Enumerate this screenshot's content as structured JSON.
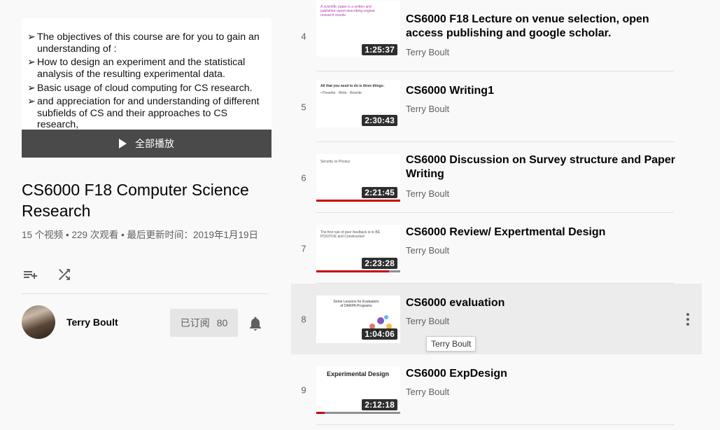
{
  "hero": {
    "bullets": [
      "The objectives of this course are for you to gain an",
      "understanding of :",
      "How to design an experiment and the statistical",
      "analysis of the resulting experimental data.",
      "Basic usage of cloud computing for CS research.",
      "and appreciation for and understanding of different",
      "subfields of CS and their approaches to CS",
      "research,"
    ],
    "play_all": "全部播放"
  },
  "playlist": {
    "title": "CS6000 F18 Computer Science Research",
    "stats": "15 个视频 • 229 次观看 • 最后更新时间：2019年1月19日",
    "owner": "Terry Boult",
    "subscribe_label": "已订阅",
    "subscriber_count": "80"
  },
  "videos": [
    {
      "index": "4",
      "title": "CS6000 F18 Lecture on venue selection, open access publishing and google scholar.",
      "channel": "Terry Boult",
      "duration": "1:25:37",
      "progress": 0
    },
    {
      "index": "5",
      "title": "CS6000 Writing1",
      "channel": "Terry Boult",
      "duration": "2:30:43",
      "progress": 0
    },
    {
      "index": "6",
      "title": "CS6000 Discussion on Survey structure and Paper Writing",
      "channel": "Terry Boult",
      "duration": "2:21:45",
      "progress": 1.0
    },
    {
      "index": "7",
      "title": "CS6000 Review/ Expertmental Design",
      "channel": "Terry Boult",
      "duration": "2:23:28",
      "progress": 0.87
    },
    {
      "index": "8",
      "title": "CS6000 evaluation",
      "channel": "Terry Boult",
      "duration": "1:04:06",
      "progress": 0
    },
    {
      "index": "9",
      "title": "CS6000 ExpDesign",
      "channel": "Terry Boult",
      "duration": "2:12:18",
      "progress": 0.1
    }
  ],
  "thumb_text": {
    "v4": "A scientific paper is a written and published report describing original research results.",
    "v5": "All that you need to do is three things:",
    "v6": "Security vs Privacy",
    "v7": "The first rule of peer feedback is to BE POSITIVE and Constructive!",
    "v8": "Some Lessons for Evaluators of DARPA Programs",
    "v9": "Experimental Design"
  },
  "tooltip": "Terry Boult",
  "colors": {
    "progress": "#cc0000",
    "accent_text": "#030303",
    "secondary_text": "#606060"
  }
}
